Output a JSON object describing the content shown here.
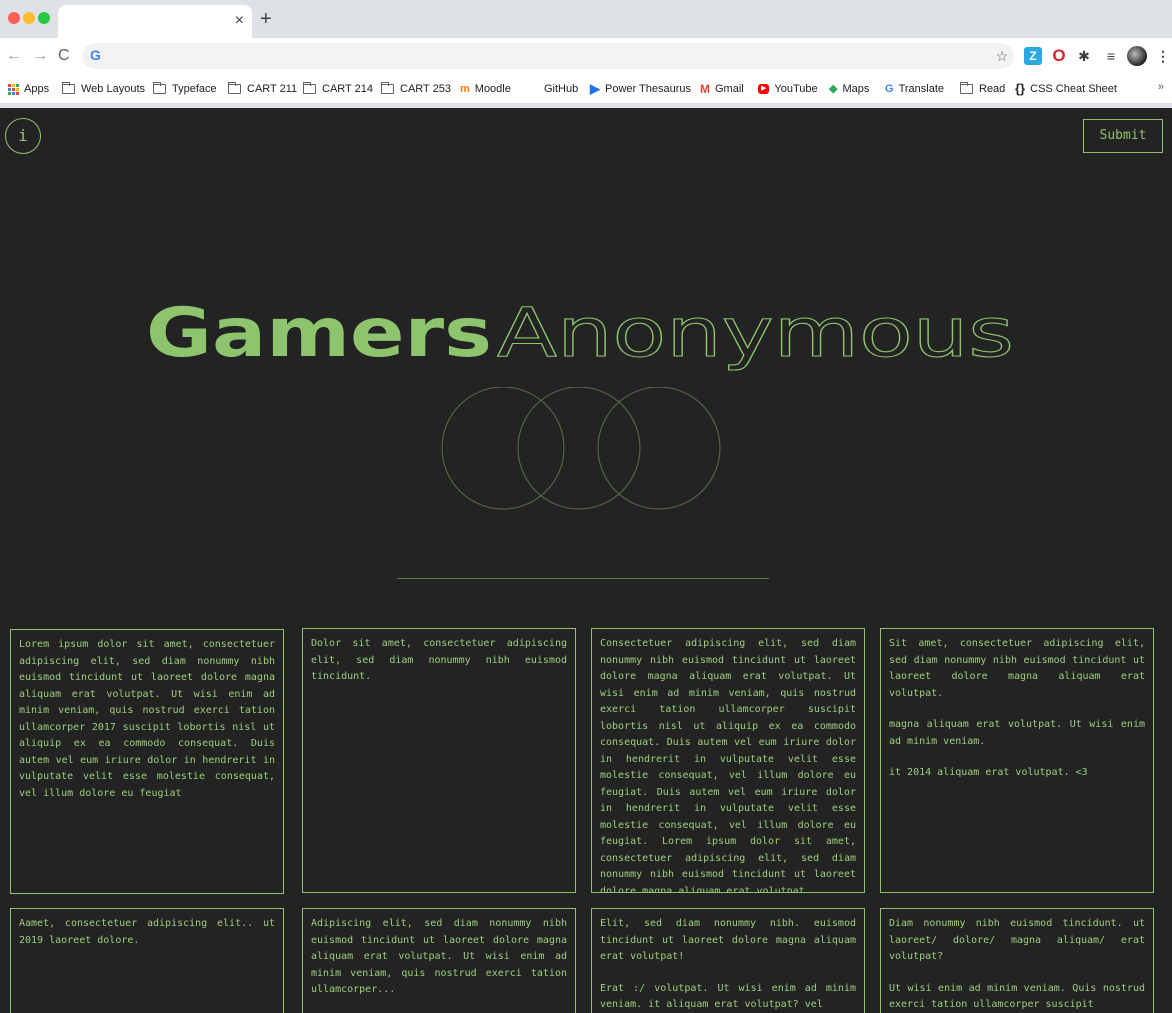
{
  "browser": {
    "tab_close": "×",
    "new_tab": "+",
    "nav": {
      "back": "←",
      "forward": "→",
      "reload": "C"
    },
    "omnibox_value": "",
    "google_glyph": "G",
    "icons": [
      "star-icon",
      "extension-icon",
      "opera-icon",
      "puzzle-icon",
      "media-queue-icon",
      "profile-avatar",
      "menu-icon"
    ],
    "bookmarks": [
      {
        "label": "Apps",
        "icon": "apps-grid-icon"
      },
      {
        "label": "Web Layouts",
        "icon": "folder-icon"
      },
      {
        "label": "Typeface",
        "icon": "folder-icon"
      },
      {
        "label": "CART 211",
        "icon": "folder-icon"
      },
      {
        "label": "CART 214",
        "icon": "folder-icon"
      },
      {
        "label": "CART 253",
        "icon": "folder-icon"
      },
      {
        "label": "Moodle",
        "icon": "moodle-icon"
      },
      {
        "label": "GitHub",
        "icon": ""
      },
      {
        "label": "Power Thesaurus",
        "icon": "power-thesaurus-icon"
      },
      {
        "label": "Gmail",
        "icon": "gmail-icon"
      },
      {
        "label": "YouTube",
        "icon": "youtube-icon"
      },
      {
        "label": "Maps",
        "icon": "maps-icon"
      },
      {
        "label": "Translate",
        "icon": "translate-icon"
      },
      {
        "label": "Read",
        "icon": "folder-icon"
      },
      {
        "label": "CSS Cheat Sheet",
        "icon": "braces-icon"
      }
    ],
    "bookmarks_overflow": "»"
  },
  "page": {
    "info_label": "i",
    "submit_label": "Submit",
    "title_solid": "Gamers",
    "title_outline": "Anonymous",
    "accent_color": "#8fc46f",
    "background_color": "#232323",
    "cards": [
      {
        "paragraphs": [
          "Lorem ipsum dolor sit amet, consectetuer adipiscing elit, sed diam nonummy nibh euismod tincidunt ut laoreet dolore magna aliquam erat volutpat. Ut wisi enim ad minim veniam, quis nostrud exerci tation ullamcorper 2017 suscipit lobortis nisl ut aliquip ex ea commodo consequat. Duis autem vel eum iriure dolor in hendrerit in vulputate velit esse molestie consequat, vel illum dolore eu feugiat"
        ]
      },
      {
        "paragraphs": [
          "Dolor sit amet, consectetuer adipiscing elit, sed diam nonummy nibh euismod tincidunt."
        ]
      },
      {
        "paragraphs": [
          "Consectetuer adipiscing elit, sed diam nonummy nibh euismod tincidunt ut laoreet dolore magna aliquam erat volutpat. Ut wisi enim ad minim veniam, quis nostrud exerci tation ullamcorper suscipit lobortis nisl ut aliquip ex ea commodo consequat. Duis autem vel eum iriure dolor in hendrerit in vulputate velit esse molestie consequat, vel illum dolore eu feugiat. Duis autem vel eum iriure dolor in hendrerit in vulputate velit esse molestie consequat, vel illum dolore eu feugiat. Lorem ipsum dolor sit amet, consectetuer adipiscing elit, sed diam nonummy nibh euismod tincidunt ut laoreet dolore magna aliquam erat volutpat."
        ]
      },
      {
        "paragraphs": [
          "Sit amet, consectetuer adipiscing elit, sed diam nonummy nibh euismod tincidunt ut laoreet dolore magna aliquam erat volutpat.",
          "magna aliquam erat volutpat. Ut wisi enim ad minim veniam.",
          "it 2014 aliquam erat volutpat. <3"
        ]
      },
      {
        "paragraphs": [
          "Aamet, consectetuer adipiscing elit.. ut 2019 laoreet dolore."
        ]
      },
      {
        "paragraphs": [
          "Adipiscing elit, sed diam nonummy nibh euismod tincidunt ut laoreet dolore magna aliquam erat volutpat. Ut wisi enim ad minim veniam, quis nostrud exerci tation ullamcorper..."
        ]
      },
      {
        "paragraphs": [
          "Elit, sed diam nonummy nibh. euismod tincidunt ut laoreet dolore magna aliquam erat volutpat!",
          "Erat :/ volutpat. Ut wisi enim ad minim veniam. it aliquam erat volutpat? vel"
        ]
      },
      {
        "paragraphs": [
          "Diam nonummy nibh euismod tincidunt. ut laoreet/ dolore/ magna aliquam/ erat volutpat?",
          "Ut wisi enim ad minim veniam. Quis nostrud exerci tation ullamcorper suscipit"
        ]
      }
    ]
  }
}
